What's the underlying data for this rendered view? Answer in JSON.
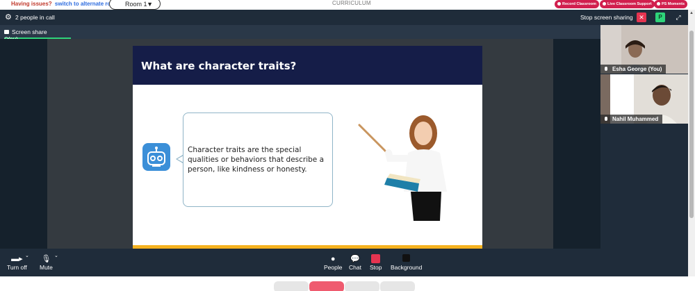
{
  "topbar": {
    "issues_text": "Having issues?",
    "alternate_link": "switch to alternate room",
    "room_select": "Room 1",
    "page_heading": "CURRICULUM",
    "pills": [
      "Record Classroom",
      "Live Classroom Support",
      "PS Moments"
    ]
  },
  "meeting": {
    "people_count": "2 people in call",
    "stop_sharing": "Stop screen sharing",
    "p_badge": "P",
    "tab_label": "Screen share (You)",
    "tab_menu": "···"
  },
  "slide": {
    "title": "What are character traits?",
    "bubble_text": "Character traits are the special qualities or behaviors that describe a person, like kindness or honesty."
  },
  "participants": [
    {
      "name": "Esha George (You)"
    },
    {
      "name": "Nahil Muhammed"
    }
  ],
  "controls": {
    "camera": "Turn off",
    "mic": "Mute",
    "people": "People",
    "chat": "Chat",
    "stop": "Stop",
    "background": "Background"
  },
  "colors": {
    "accent_green": "#2ed47a",
    "danger_red": "#e53450",
    "slide_navy": "#151d48",
    "slide_yellow": "#f5b21f"
  }
}
